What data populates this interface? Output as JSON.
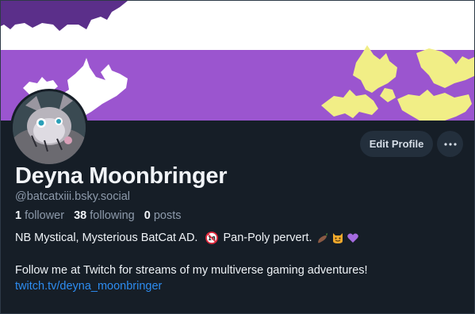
{
  "profile": {
    "display_name": "Deyna Moonbringer",
    "handle": "@batcatxiii.bsky.social",
    "stats": {
      "followers_count": "1",
      "followers_label": "follower",
      "following_count": "38",
      "following_label": "following",
      "posts_count": "0",
      "posts_label": "posts"
    },
    "bio": {
      "line1_a": "NB Mystical, Mysterious BatCat AD.",
      "line1_b": "Pan-Poly pervert.",
      "line2": "Follow me at Twitch for streams of my multiverse gaming adventures!",
      "link": "twitch.tv/deyna_moonbringer"
    },
    "emoji_icons": [
      "no-under-18-icon",
      "eggplant-icon",
      "smiling-cat-devil-icon",
      "purple-heart-icon"
    ]
  },
  "actions": {
    "edit_profile_label": "Edit Profile",
    "more_icon": "ellipsis-icon"
  },
  "colors": {
    "background": "#161e27",
    "banner_purple": "#9b55cf",
    "banner_white": "#ffffff",
    "bat_dark": "#5b2f8a",
    "bat_yellow": "#f1ee86",
    "link": "#2d8cf0",
    "button_bg": "#232f3c"
  }
}
